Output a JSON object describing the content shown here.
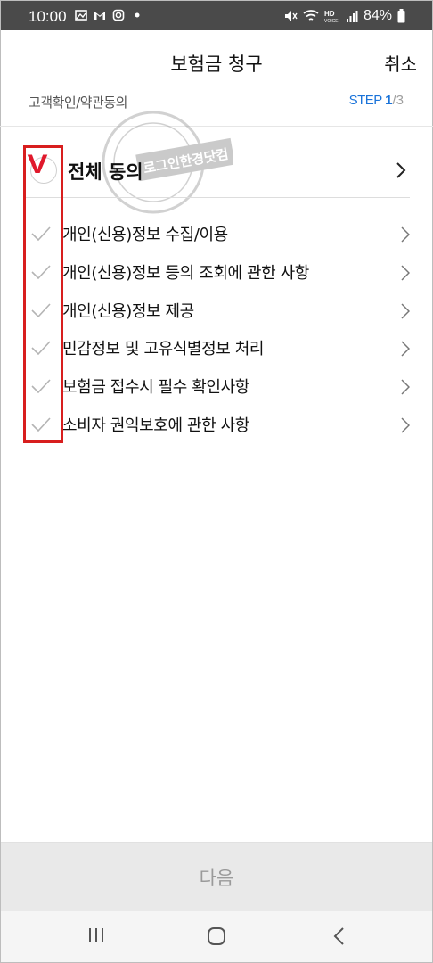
{
  "status_bar": {
    "time": "10:00",
    "battery": "84%",
    "left_icons": [
      "gallery-icon",
      "gmail-icon",
      "instagram-icon",
      "dot-icon"
    ],
    "right_icons": [
      "mute-icon",
      "wifi-icon",
      "hd-voice-icon",
      "signal-icon",
      "battery-icon"
    ]
  },
  "header": {
    "title": "보험금 청구",
    "cancel_label": "취소"
  },
  "step": {
    "label": "고객확인/약관동의",
    "word": "STEP ",
    "current": "1",
    "total": "/3"
  },
  "agree_all": {
    "label": "전체 동의"
  },
  "items": [
    {
      "label": "개인(신용)정보 수집/이용"
    },
    {
      "label": "개인(신용)정보 등의 조회에 관한 사항"
    },
    {
      "label": "개인(신용)정보 제공"
    },
    {
      "label": "민감정보 및 고유식별정보 처리"
    },
    {
      "label": "보험금 접수시 필수 확인사항"
    },
    {
      "label": "소비자 권익보호에 관한 사항"
    }
  ],
  "annotation": {
    "mark": "V",
    "color": "#d81e1e"
  },
  "watermark": {
    "text": "로그인한경닷컴"
  },
  "footer": {
    "next_label": "다음"
  },
  "nav": {
    "icons": [
      "recent-apps-icon",
      "home-icon",
      "back-icon"
    ]
  },
  "colors": {
    "accent": "#1a73d9",
    "status_bar": "#4a4a4a",
    "disabled_button": "#e9e9e9"
  }
}
